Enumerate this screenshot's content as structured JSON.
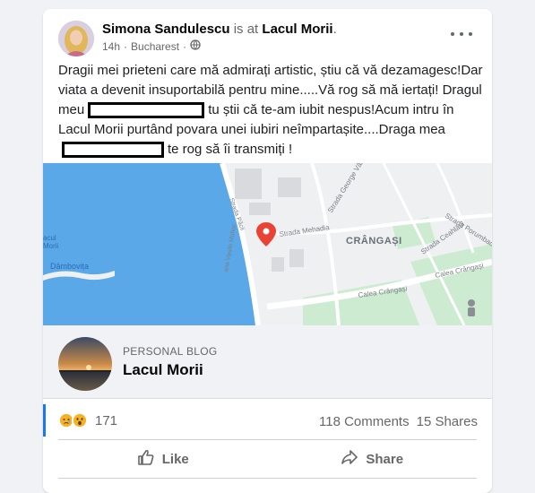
{
  "post": {
    "author": "Simona Sandulescu",
    "is_at": "is at",
    "place": "Lacul Morii",
    "place_suffix": ".",
    "time": "14h",
    "separator": "·",
    "location": "Bucharest",
    "privacy_icon": "globe-icon",
    "more_icon": "more-options-icon",
    "text": {
      "line1": "Dragii mei prieteni care mă admirați artistic, știu că vă dezamagesc!Dar viata a devenit insuportabilă pentru mine.....Vă rog să mă iertați!",
      "line2_pre": "Dragul meu",
      "line2_post": "tu știi că te-am iubit nespus!Acum intru în Lacul Morii purtând povara unei iubiri neîmpartașite....Draga",
      "line3_pre": "mea",
      "line3_post": "te rog să îi transmiți !"
    }
  },
  "map": {
    "labels": {
      "strada_mehadia": "Strada Mehadia",
      "crangasi": "CRÂNGAȘI",
      "dambovita": "Dâmbovița",
      "lacul_morii": "acul\nMorii",
      "calea_crangasi": "Calea Crângași",
      "calea_crangasi_2": "Calea Crângași",
      "strada_george_valsan": "Strada George Vâlsan",
      "strada_porumbacu": "Strada Porumbacu",
      "strada_ceahlaul": "Strada Ceahlăul",
      "splaiul": "Splaiul Vasile Militaru",
      "strada_pacii": "Strada Păcii",
      "strada_vasile_mohor": "ana Vasile Mohor"
    },
    "pin_icon": "map-pin-icon",
    "street_view_icon": "pegman-icon",
    "colors": {
      "water": "#5aa8e8",
      "park": "#cdebd0",
      "road": "#ffffff",
      "land": "#eef0f2",
      "pin": "#ea4335"
    }
  },
  "blog": {
    "type": "PERSONAL BLOG",
    "title": "Lacul Morii"
  },
  "stats": {
    "reaction_icons": [
      "sad-reaction-icon",
      "wow-reaction-icon"
    ],
    "reaction_count": "171",
    "comments": "118 Comments",
    "shares": "15 Shares"
  },
  "actions": {
    "like": "Like",
    "share": "Share",
    "like_icon": "thumbs-up-icon",
    "share_icon": "share-arrow-icon"
  },
  "colors": {
    "accent": "#1877f2",
    "secondary_text": "#65676b"
  }
}
